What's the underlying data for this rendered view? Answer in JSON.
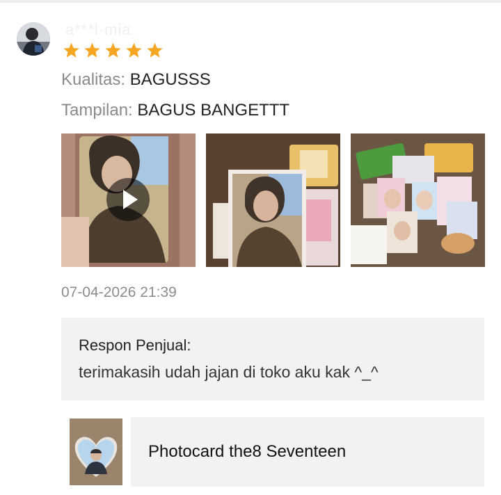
{
  "review": {
    "username": "a***l·mia.",
    "rating": 5,
    "attributes": [
      {
        "key": "Kualitas:",
        "value": "BAGUSSS"
      },
      {
        "key": "Tampilan:",
        "value": "BAGUS BANGETTT"
      }
    ],
    "media": [
      {
        "type": "video",
        "icon": "play-icon"
      },
      {
        "type": "image"
      },
      {
        "type": "image"
      }
    ],
    "date": "07-04-2026 21:39"
  },
  "seller_reply": {
    "title": "Respon Penjual:",
    "body": "terimakasih udah jajan di toko aku kak ^_^"
  },
  "product": {
    "name": "Photocard the8 Seventeen"
  },
  "colors": {
    "star": "#f6a623",
    "reply_bg": "#f2f2f2",
    "muted_text": "#8a8a8a"
  }
}
